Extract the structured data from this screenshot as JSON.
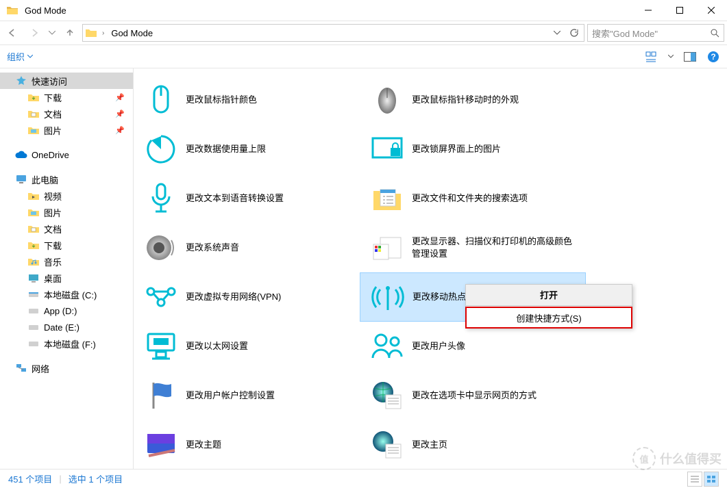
{
  "window": {
    "title": "God Mode"
  },
  "nav": {
    "crumb": "God Mode"
  },
  "search": {
    "placeholder": "搜索\"God Mode\""
  },
  "cmdbar": {
    "organize": "组织"
  },
  "sidebar": {
    "quick_access": "快速访问",
    "downloads": "下载",
    "documents": "文档",
    "pictures": "图片",
    "onedrive": "OneDrive",
    "this_pc": "此电脑",
    "videos": "视频",
    "pictures2": "图片",
    "documents2": "文档",
    "downloads2": "下载",
    "music": "音乐",
    "desktop": "桌面",
    "disk_c": "本地磁盘 (C:)",
    "disk_d": "App (D:)",
    "disk_e": "Date (E:)",
    "disk_f": "本地磁盘 (F:)",
    "network": "网络"
  },
  "items": {
    "left": [
      "更改鼠标指针颜色",
      "更改数据使用量上限",
      "更改文本到语音转换设置",
      "更改系统声音",
      "更改虚拟专用网络(VPN)",
      "更改以太网设置",
      "更改用户帐户控制设置",
      "更改主题"
    ],
    "right": [
      "更改鼠标指针移动时的外观",
      "更改锁屏界面上的图片",
      "更改文件和文件夹的搜索选项",
      "更改显示器、扫描仪和打印机的高级颜色管理设置",
      "更改移动热点设置",
      "更改用户头像",
      "更改在选项卡中显示网页的方式",
      "更改主页"
    ]
  },
  "context_menu": {
    "open": "打开",
    "create_shortcut": "创建快捷方式(S)"
  },
  "status": {
    "total": "451 个项目",
    "selected": "选中 1 个项目"
  },
  "watermark": {
    "site": "什么值得买",
    "mark": "值"
  }
}
